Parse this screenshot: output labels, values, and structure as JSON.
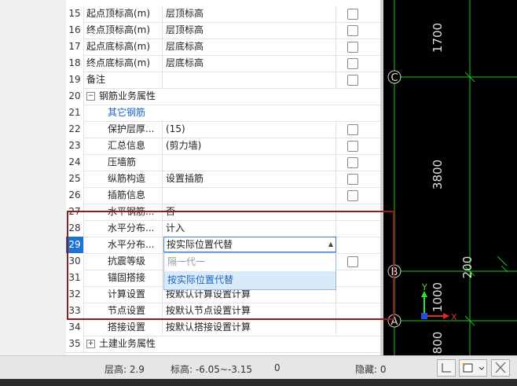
{
  "rows": [
    {
      "n": "15",
      "name": "起点顶标高(m)",
      "value": "层顶标高"
    },
    {
      "n": "16",
      "name": "终点顶标高(m)",
      "value": "层顶标高"
    },
    {
      "n": "17",
      "name": "起点底标高(m)",
      "value": "层底标高"
    },
    {
      "n": "18",
      "name": "终点底标高(m)",
      "value": "层底标高"
    },
    {
      "n": "19",
      "name": "备注",
      "value": ""
    },
    {
      "n": "20",
      "name": "钢筋业务属性",
      "value": ""
    },
    {
      "n": "21",
      "name": "其它钢筋",
      "value": ""
    },
    {
      "n": "22",
      "name": "保护层厚...",
      "value": "(15)"
    },
    {
      "n": "23",
      "name": "汇总信息",
      "value": "(剪力墙)"
    },
    {
      "n": "24",
      "name": "压墙筋",
      "value": ""
    },
    {
      "n": "25",
      "name": "纵筋构造",
      "value": "设置插筋"
    },
    {
      "n": "26",
      "name": "插筋信息",
      "value": ""
    },
    {
      "n": "27",
      "name": "水平钢筋...",
      "value": "否"
    },
    {
      "n": "28",
      "name": "水平分布...",
      "value": "计入"
    },
    {
      "n": "29",
      "name": "水平分布...",
      "value": "按实际位置代替"
    },
    {
      "n": "30",
      "name": "抗震等级",
      "value": ""
    },
    {
      "n": "31",
      "name": "锚固搭接",
      "value": ""
    },
    {
      "n": "32",
      "name": "计算设置",
      "value": "按默认计算设置计算"
    },
    {
      "n": "33",
      "name": "节点设置",
      "value": "按默认节点设置计算"
    },
    {
      "n": "34",
      "name": "搭接设置",
      "value": "按默认搭接设置计算"
    },
    {
      "n": "35",
      "name": "土建业务属性",
      "value": ""
    }
  ],
  "dropdown": {
    "options": [
      "隔一代一",
      "按实际位置代替"
    ],
    "selected": "按实际位置代替"
  },
  "cad": {
    "dims": [
      "1700",
      "3800",
      "200",
      "1000",
      "800"
    ],
    "axes": [
      "C",
      "B",
      "A"
    ],
    "axis_y": "Y",
    "axis_x": "X"
  },
  "status": {
    "floor_height": "层高:  2.9",
    "elevation": "标高:  -6.05~-3.15",
    "zero": "0",
    "hidden": "隐藏:  0"
  },
  "colors": {
    "selection": "#1e72d2",
    "red_box": "#8a1d1d",
    "cad_bg": "#000000",
    "cad_green": "#1fbf1f"
  }
}
